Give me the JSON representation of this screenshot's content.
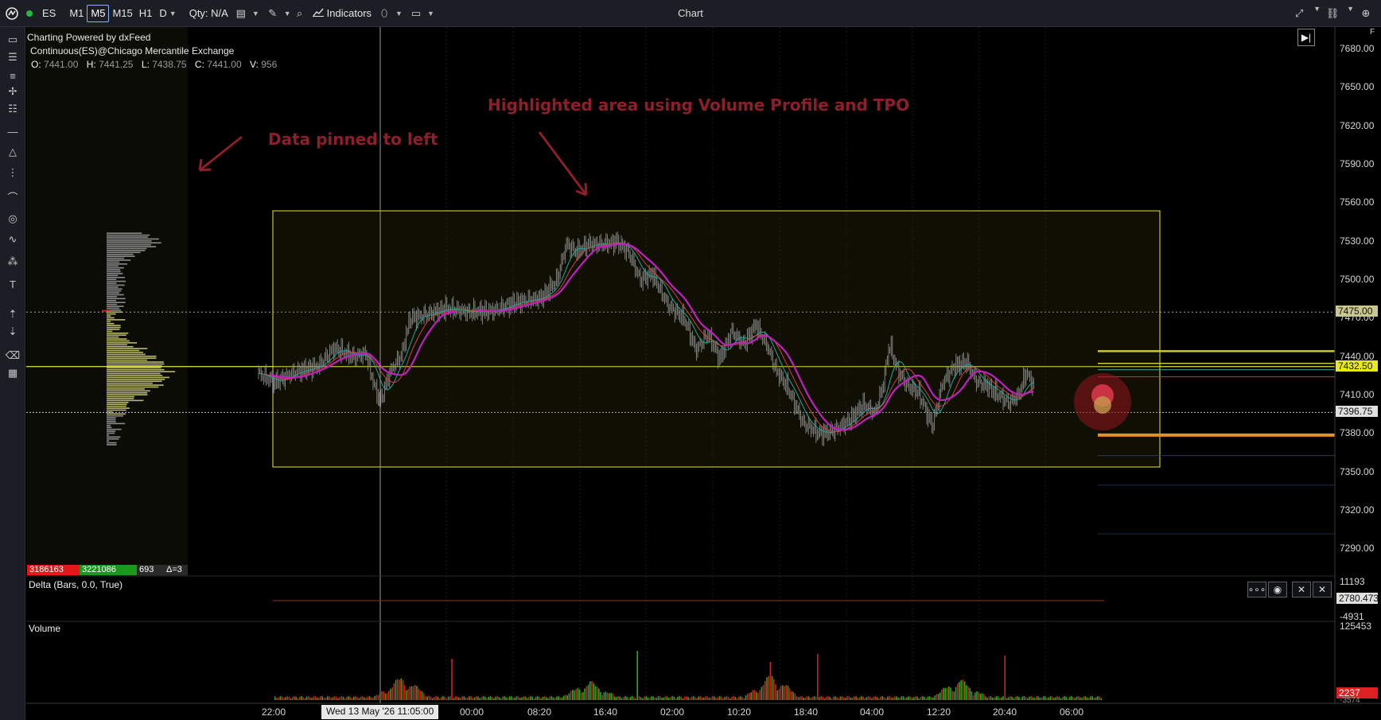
{
  "toolbar": {
    "logo_icon": "app-logo-icon",
    "status_dot_color": "#22bb44",
    "symbol": "ES",
    "timeframes": [
      "M1",
      "M5",
      "M15",
      "H1"
    ],
    "active_timeframe": "M5",
    "timeframe_dropdown": "D",
    "qty_label": "Qty: N/A",
    "indicators_label": "Indicators",
    "window_title": "Chart"
  },
  "chart": {
    "powered_by": "Charting Powered by dxFeed",
    "instrument": "Continuous(ES)@Chicago Mercantile Exchange",
    "ohlcv": [
      {
        "key": "O:",
        "value": "7441.00"
      },
      {
        "key": "H:",
        "value": "7441.25"
      },
      {
        "key": "L:",
        "value": "7438.75"
      },
      {
        "key": "C:",
        "value": "7441.00"
      },
      {
        "key": "V:",
        "value": "956"
      }
    ],
    "price_axis": [
      "7680.00",
      "7650.00",
      "7620.00",
      "7590.00",
      "7560.00",
      "7530.00",
      "7500.00",
      "7470.00",
      "7440.00",
      "7410.00",
      "7380.00",
      "7350.00",
      "7320.00",
      "7290.00"
    ],
    "price_badges": [
      {
        "value": "7475.00",
        "bg": "#c8c890",
        "fg": "#111111"
      },
      {
        "value": "7432.50",
        "bg": "#e8e820",
        "fg": "#111111"
      },
      {
        "value": "7396.75",
        "bg": "#e0e0e0",
        "fg": "#111111"
      }
    ],
    "time_axis": [
      "22:00",
      "00:00",
      "08:20",
      "16:40",
      "02:00",
      "10:20",
      "18:40",
      "04:00",
      "12:20",
      "20:40",
      "06:00"
    ],
    "crosshair_time": "Wed 13 May '26 11:05:00",
    "volume_profile_summary": [
      {
        "value": "3186163",
        "bg": "#e31919"
      },
      {
        "value": "3221086",
        "bg": "#1a9a1a"
      },
      {
        "value": "693",
        "bg": "#2a2a2a"
      },
      {
        "value": "Δ=3",
        "bg": "#2a2a2a"
      }
    ],
    "colors": {
      "highlight_border": "#e6e640",
      "price_line_yellow": "#e6e640",
      "ma_magenta": "#c020c0",
      "ma_teal": "#20a8a0",
      "ma_red": "#d04040",
      "candles_gray": "#8c8c8c",
      "profile_fill": "#b8b86a",
      "volume_green": "#22aa22",
      "volume_red": "#cc2222",
      "annotation_red": "#8b1f2b"
    }
  },
  "annotations": {
    "left_note": "Data pinned to left",
    "center_note": "Highlighted area using Volume Profile and TPO"
  },
  "delta_pane": {
    "title": "Delta (Bars, 0.0, True)",
    "axis_top": "11193",
    "axis_badge": "2780.4737",
    "axis_bottom": "-4931",
    "buttons": [
      "more-icon",
      "eye-icon",
      "collapse-icon",
      "close-icon"
    ]
  },
  "volume_pane": {
    "title": "Volume",
    "axis_top": "125453",
    "axis_badge": "2237",
    "axis_bottom": "-3574"
  }
}
